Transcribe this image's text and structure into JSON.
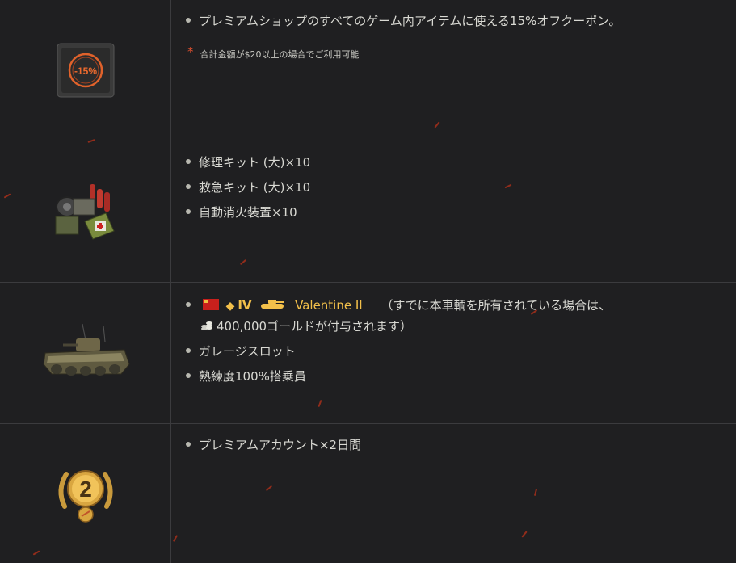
{
  "rows": [
    {
      "icon": "coupon-15-icon",
      "coupon_label": "-15%",
      "items": [
        "プレミアムショップのすべてのゲーム内アイテムに使える15%オフクーポン。"
      ],
      "note_star": "*",
      "note": "合計金額が$20以上の場合でご利用可能"
    },
    {
      "icon": "consumables-icon",
      "items": [
        "修理キット (大)×10",
        "救急キット (大)×10",
        "自動消火装置×10"
      ]
    },
    {
      "icon": "tank-icon",
      "vehicle": {
        "nation": "ussr-flag-icon",
        "type_icon": "light-tank-diamond-icon",
        "tier": "IV",
        "class_icon": "tank-silhouette-icon",
        "name": "Valentine II",
        "compensation_prefix": "（すでに本車輌を所有されている場合は、",
        "gold_icon": "gold-coins-icon",
        "compensation_amount": "400,000ゴールドが付与されます）"
      },
      "items": [
        "ガレージスロット",
        "熟練度100%搭乗員"
      ]
    },
    {
      "icon": "premium-2-days-icon",
      "badge_number": "2",
      "items": [
        "プレミアムアカウント×2日間"
      ]
    }
  ]
}
